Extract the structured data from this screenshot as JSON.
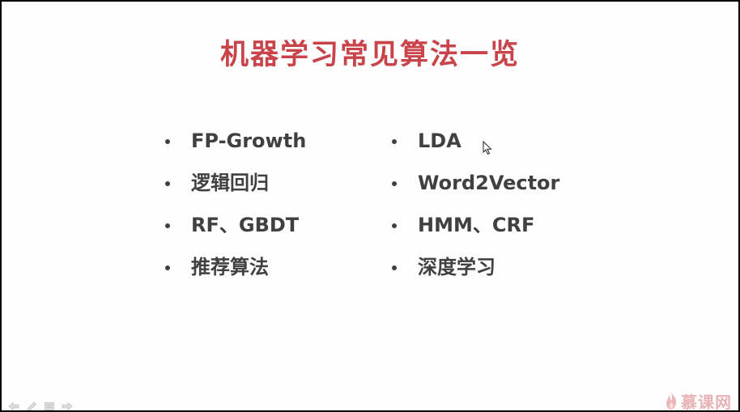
{
  "slide": {
    "title": "机器学习常见算法一览",
    "left_items": [
      {
        "label": "FP-Growth"
      },
      {
        "label": "逻辑回归"
      },
      {
        "label": "RF、GBDT"
      },
      {
        "label": "推荐算法"
      }
    ],
    "right_items": [
      {
        "label": "LDA"
      },
      {
        "label": "Word2Vector"
      },
      {
        "label": "HMM、CRF"
      },
      {
        "label": "深度学习"
      }
    ]
  },
  "watermark": {
    "logo_text": "慕课网"
  },
  "colors": {
    "title": "#c9444a",
    "body_text": "#404040",
    "watermark": "#e7b3b5"
  },
  "icons": {
    "cursor": "mouse-pointer-icon",
    "nav": [
      "previous-slide-icon",
      "pen-icon",
      "slide-menu-icon",
      "next-slide-icon"
    ],
    "logo": "flame-icon"
  }
}
